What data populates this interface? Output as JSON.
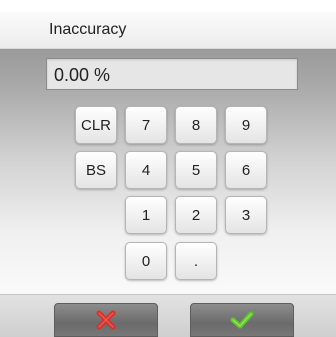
{
  "header": {
    "title": "Inaccuracy"
  },
  "display": {
    "value": "0.00 %"
  },
  "keypad": {
    "clr": "CLR",
    "bs": "BS",
    "k7": "7",
    "k8": "8",
    "k9": "9",
    "k4": "4",
    "k5": "5",
    "k6": "6",
    "k1": "1",
    "k2": "2",
    "k3": "3",
    "k0": "0",
    "dot": "."
  },
  "footer": {
    "cancel_icon": "close-icon",
    "ok_icon": "checkmark-icon",
    "cancel_color": "#d8312c",
    "ok_color": "#5fc62a"
  }
}
